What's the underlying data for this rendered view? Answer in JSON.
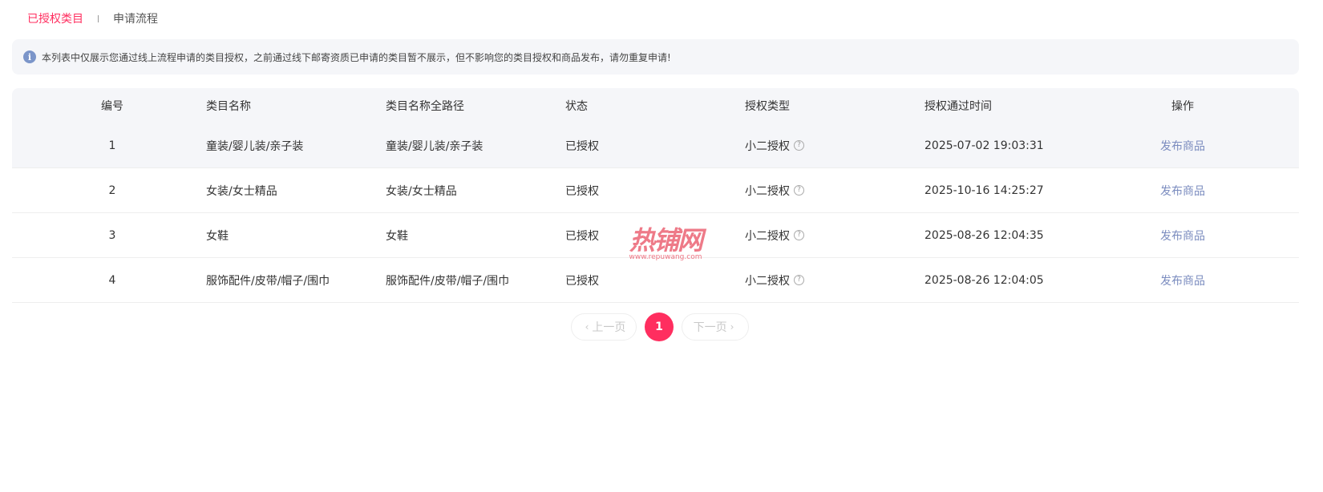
{
  "tabs": [
    {
      "label": "已授权类目",
      "active": true
    },
    {
      "label": "申请流程",
      "active": false
    }
  ],
  "banner": {
    "icon": "info-icon",
    "text": "本列表中仅展示您通过线上流程申请的类目授权，之前通过线下邮寄资质已申请的类目暂不展示，但不影响您的类目授权和商品发布，请勿重复申请!"
  },
  "table": {
    "headers": {
      "id": "编号",
      "name": "类目名称",
      "path": "类目名称全路径",
      "status": "状态",
      "type": "授权类型",
      "time": "授权通过时间",
      "op": "操作"
    },
    "rows": [
      {
        "id": "1",
        "name": "童装/婴儿装/亲子装",
        "path": "童装/婴儿装/亲子装",
        "status": "已授权",
        "type": "小二授权",
        "time": "2025-07-02 19:03:31",
        "op": "发布商品"
      },
      {
        "id": "2",
        "name": "女装/女士精品",
        "path": "女装/女士精品",
        "status": "已授权",
        "type": "小二授权",
        "time": "2025-10-16 14:25:27",
        "op": "发布商品"
      },
      {
        "id": "3",
        "name": "女鞋",
        "path": "女鞋",
        "status": "已授权",
        "type": "小二授权",
        "time": "2025-08-26 12:04:35",
        "op": "发布商品"
      },
      {
        "id": "4",
        "name": "服饰配件/皮带/帽子/围巾",
        "path": "服饰配件/皮带/帽子/围巾",
        "status": "已授权",
        "type": "小二授权",
        "time": "2025-08-26 12:04:05",
        "op": "发布商品"
      }
    ]
  },
  "watermark": {
    "main": "热铺网",
    "sub": "www.repuwang.com"
  },
  "pagination": {
    "prev_label": "上一页",
    "current_page": "1",
    "next_label": "下一页"
  },
  "colors": {
    "accent": "#ff2e5f",
    "link": "#7b8cbf",
    "banner_bg": "#f5f6f9"
  }
}
